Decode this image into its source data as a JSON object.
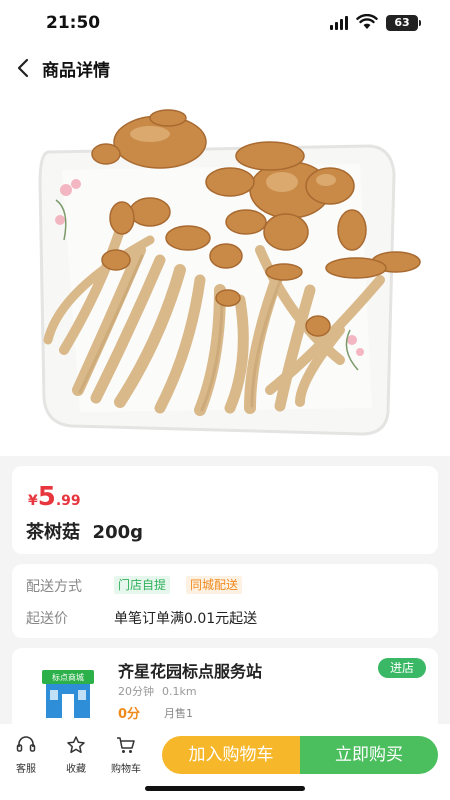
{
  "status_bar": {
    "time": "21:50",
    "battery": "63"
  },
  "nav": {
    "title": "商品详情",
    "back_icon": "chevron-left-icon"
  },
  "gallery": {
    "image_count": 3,
    "active_index": 0,
    "image_subject": "mushroom-bunch-on-plate"
  },
  "product": {
    "currency": "¥",
    "price_int": "5",
    "price_dec": ".99",
    "name": "茶树菇",
    "spec": "200g"
  },
  "delivery": {
    "method_label": "配送方式",
    "tags": [
      "门店自提",
      "同城配送"
    ],
    "min_label": "起送价",
    "min_text": "单笔订单满0.01元起送"
  },
  "store": {
    "name": "齐星花园标点服务站",
    "enter_label": "进店",
    "time": "20分钟",
    "distance": "0.1km",
    "score": "0分",
    "monthly_sales": "月售1",
    "logo_sign": "标点商城"
  },
  "bottom_bar": {
    "service_label": "客服",
    "favorite_label": "收藏",
    "cart_label": "购物车",
    "add_to_cart": "加入购物车",
    "buy_now": "立即购买"
  },
  "colors": {
    "accent_green": "#3ab866",
    "price_red": "#e8363f",
    "cart_yellow": "#f6b72a",
    "buy_green": "#4bbe5e",
    "tag_orange": "#f08a1b"
  }
}
